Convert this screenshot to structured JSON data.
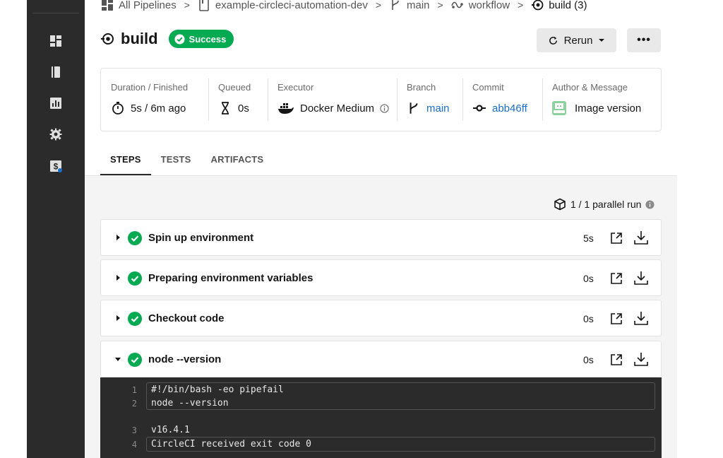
{
  "sidebar": {
    "items": [
      {
        "icon": "dashboard-icon"
      },
      {
        "icon": "projects-icon"
      },
      {
        "icon": "insights-icon"
      },
      {
        "icon": "settings-icon"
      },
      {
        "icon": "plan-icon"
      }
    ]
  },
  "breadcrumb": {
    "items": [
      {
        "label": "All Pipelines",
        "icon": "pipelines-icon"
      },
      {
        "label": "example-circleci-automation-dev",
        "icon": "project-icon"
      },
      {
        "label": "main",
        "icon": "branch-icon"
      },
      {
        "label": "workflow",
        "icon": "workflow-icon"
      },
      {
        "label": "build (3)",
        "icon": "job-icon"
      }
    ],
    "separator": ">"
  },
  "job": {
    "title": "build",
    "status": "Success"
  },
  "actions": {
    "rerun_label": "Rerun",
    "more_label": "•••"
  },
  "info": {
    "duration": {
      "label": "Duration / Finished",
      "value": "5s / 6m ago"
    },
    "queued": {
      "label": "Queued",
      "value": "0s"
    },
    "executor": {
      "label": "Executor",
      "value": "Docker Medium"
    },
    "branch": {
      "label": "Branch",
      "value": "main"
    },
    "commit": {
      "label": "Commit",
      "value": "abb46ff"
    },
    "author": {
      "label": "Author & Message",
      "value": "Image version"
    }
  },
  "tabs": [
    {
      "label": "STEPS",
      "active": true
    },
    {
      "label": "TESTS",
      "active": false
    },
    {
      "label": "ARTIFACTS",
      "active": false
    }
  ],
  "parallel_runs": "1 / 1 parallel run",
  "steps": [
    {
      "name": "Spin up environment",
      "duration": "5s",
      "expanded": false
    },
    {
      "name": "Preparing environment variables",
      "duration": "0s",
      "expanded": false
    },
    {
      "name": "Checkout code",
      "duration": "0s",
      "expanded": false
    },
    {
      "name": "node --version",
      "duration": "0s",
      "expanded": true
    }
  ],
  "output": {
    "lines": [
      {
        "num": "1",
        "text": "#!/bin/bash -eo pipefail"
      },
      {
        "num": "2",
        "text": "node --version"
      },
      {
        "num": "3",
        "text": "v16.4.1"
      },
      {
        "num": "4",
        "text": "CircleCI received exit code 0"
      }
    ]
  },
  "colors": {
    "success": "#04aa51",
    "link": "#1a6fcb",
    "sidebar": "#2b2b2b",
    "terminal": "#2b2b2b"
  }
}
